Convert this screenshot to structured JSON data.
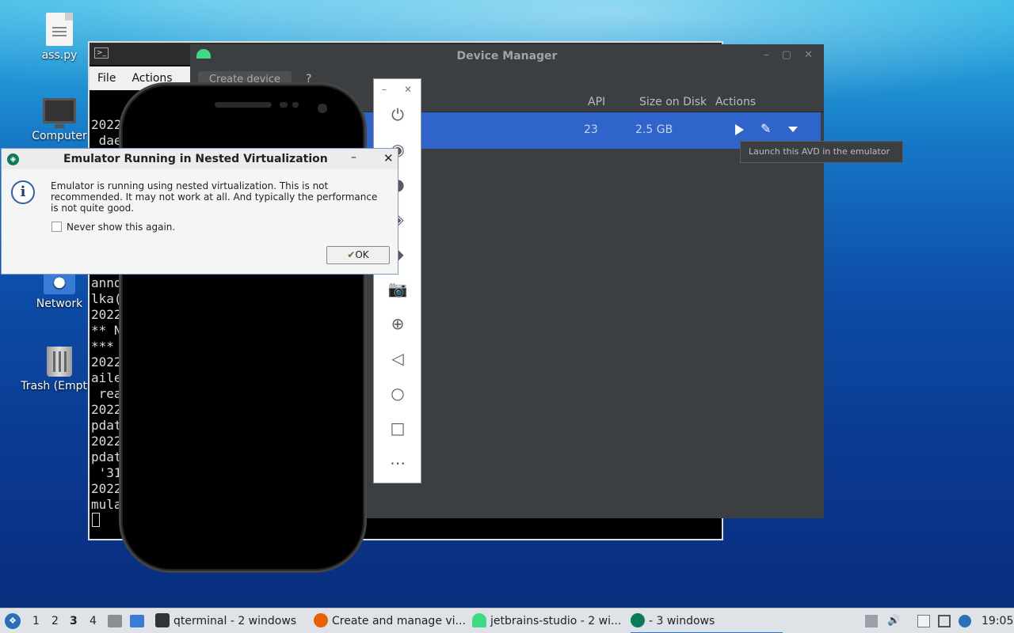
{
  "desktop": {
    "icons": [
      {
        "label": "ass.py"
      },
      {
        "label": "Computer"
      },
      {
        "label": "Network"
      },
      {
        "label": "Trash (Empty)"
      }
    ]
  },
  "terminal": {
    "menu": {
      "file": "File",
      "actions": "Actions"
    },
    "lines": [
      "2022",
      " dae",
      "",
      "",
      "",
      "",
      "",
      "",
      "",
      "",
      "anno",
      "lka(",
      "2022",
      "** N",
      "***",
      "2022",
      "aile",
      " rea",
      "2022",
      "pdat",
      "2022",
      "pdat",
      " '31",
      "2022",
      "mula"
    ]
  },
  "device_manager": {
    "title": "Device Manager",
    "create_button": "Create device",
    "help": "?",
    "columns": {
      "api": "API",
      "size": "Size on Disk",
      "actions": "Actions"
    },
    "row": {
      "api": "23",
      "size": "2.5 GB"
    },
    "tooltip": "Launch this AVD in the emulator"
  },
  "dialog": {
    "title": "Emulator Running in Nested Virtualization",
    "message": "Emulator is running using nested virtualization. This is not recommended. It may not work at all. And typically the performance is not quite good.",
    "checkbox_label": "Never show this again.",
    "ok_label": "OK"
  },
  "taskbar": {
    "workspaces": [
      "1",
      "2",
      "3",
      "4"
    ],
    "tasks": {
      "qterminal": "qterminal - 2 windows",
      "firefox": "Create and manage vi...",
      "studio": "jetbrains-studio - 2 wi...",
      "emulator": "- 3 windows"
    },
    "clock": "19:05"
  }
}
